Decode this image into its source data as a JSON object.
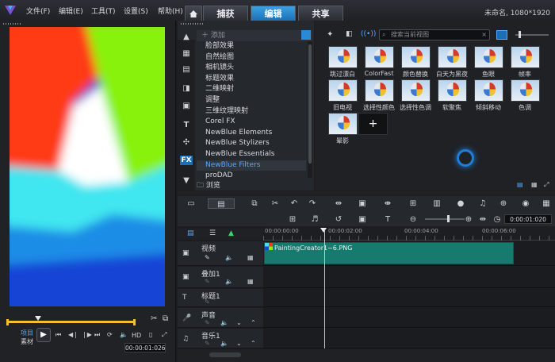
{
  "menu": {
    "file": "文件(F)",
    "edit": "编辑(E)",
    "tools": "工具(T)",
    "settings": "设置(S)",
    "help": "帮助(H)"
  },
  "tabs": [
    {
      "label": "捕获",
      "active": false
    },
    {
      "label": "编辑",
      "active": true
    },
    {
      "label": "共享",
      "active": false
    }
  ],
  "project": {
    "title": "未命名, 1080*1920"
  },
  "library": {
    "add_label": "添加",
    "categories": [
      "脸部效果",
      "自然绘图",
      "相机镜头",
      "标题效果",
      "二维映射",
      "调整",
      "三维纹理映射",
      "Corel FX",
      "NewBlue Elements",
      "NewBlue Stylizers",
      "NewBlue Essentials",
      "NewBlue Filters",
      "proDAD"
    ],
    "selected": "NewBlue Filters",
    "browse_label": "浏览",
    "search_placeholder": "搜索当前视图",
    "sidebar_fx": "FX",
    "thumbs_row1": [
      "跳过漂白",
      "ColorFast",
      "颜色替换",
      "白天为黑夜",
      "鱼眼",
      "帧率"
    ],
    "thumbs_row2": [
      "旧电视",
      "选择性颜色",
      "选择性色调",
      "软聚焦",
      "倾斜移动",
      "色调"
    ],
    "thumbs_row3": [
      "晕影"
    ]
  },
  "player": {
    "project_label": "项目",
    "clip_label": "素材",
    "hd_label": "HD",
    "timecode": "00:00:01:026"
  },
  "timeline": {
    "timecode": "0:00:01:020",
    "ruler": [
      "00:00:00:00",
      "00:00:02:00",
      "00:00:04:00",
      "00:00:06:00"
    ],
    "tracks": [
      {
        "name": "视频"
      },
      {
        "name": "叠加1"
      },
      {
        "name": "标题1"
      },
      {
        "name": "声音"
      },
      {
        "name": "音乐1"
      }
    ],
    "clip_label": "PaintingCreator1~6.PNG"
  },
  "colors": {
    "accent": "#2a8ad8",
    "clip": "#177a6e"
  }
}
